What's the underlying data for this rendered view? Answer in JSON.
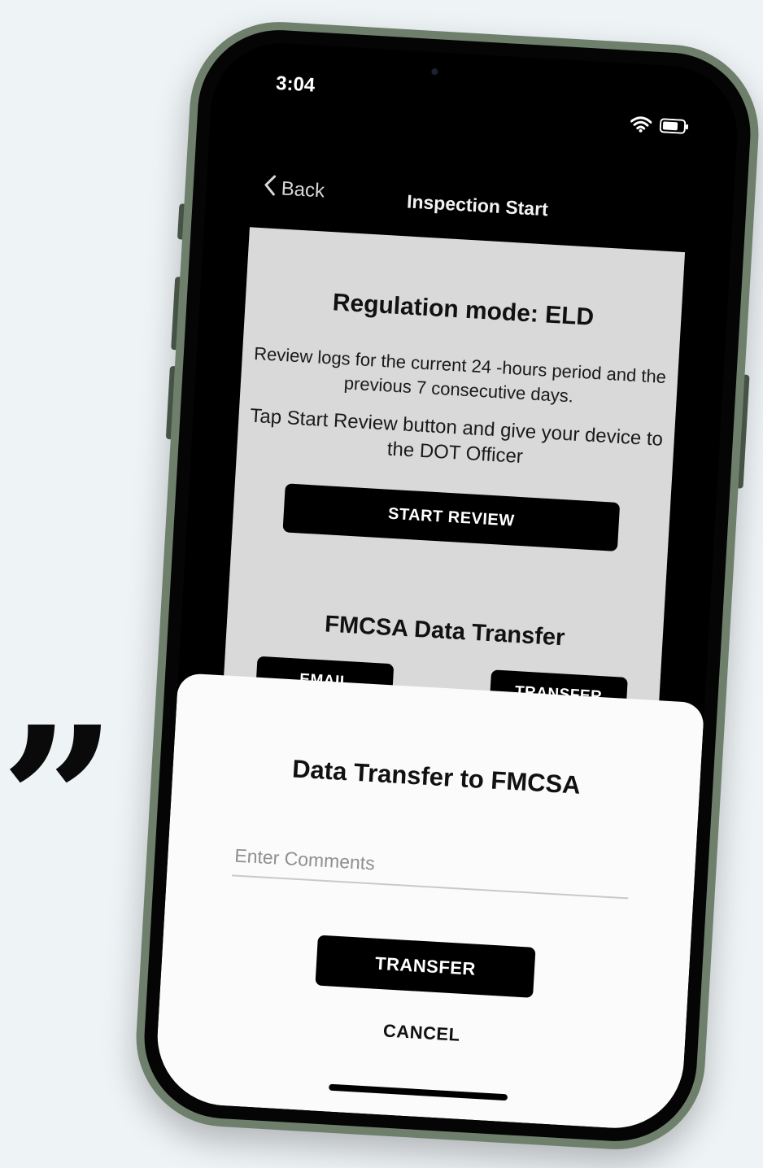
{
  "status_bar": {
    "time": "3:04",
    "wifi_icon": "wifi-icon",
    "battery_icon": "battery-icon"
  },
  "nav": {
    "back_label": "Back",
    "title": "Inspection Start"
  },
  "inspection": {
    "regulation_title": "Regulation mode: ELD",
    "description": "Review logs for the current 24 -hours period and the previous 7 consecutive days.",
    "instruction": "Tap Start Review button and give your device to the DOT Officer",
    "start_review_label": "START REVIEW"
  },
  "fmcsa": {
    "title": "FMCSA Data Transfer",
    "email_label": "EMAIL",
    "transfer_label": "TRANSFER"
  },
  "dialog": {
    "title": "Data Transfer to FMCSA",
    "comments_placeholder": "Enter Comments",
    "comments_value": "",
    "transfer_label": "TRANSFER",
    "cancel_label": "CANCEL"
  },
  "decor": {
    "quote_mark": "”"
  },
  "colors": {
    "background": "#eef3f6",
    "phone_frame": "#6e7f6c",
    "screen_content": "#d9d9d9",
    "button": "#000000",
    "sheet": "#fbfbfb"
  }
}
